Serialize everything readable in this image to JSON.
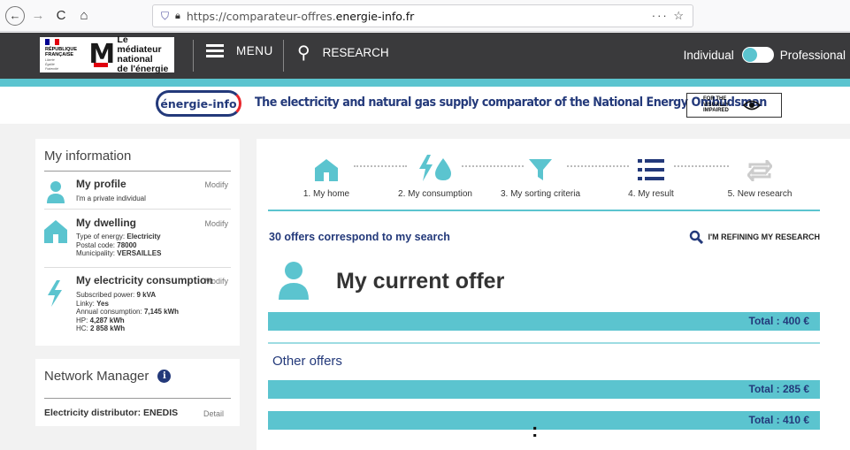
{
  "browser": {
    "url_prefix": "https://comparateur-offres.",
    "url_domain": "energie-info.fr",
    "actions": "··· ☆"
  },
  "header": {
    "republique": [
      "RÉPUBLIQUE",
      "FRANÇAISE"
    ],
    "motto": [
      "Liberté",
      "Égalité",
      "Fraternité"
    ],
    "mediateur": [
      "Le médiateur",
      "national",
      "de l'énergie"
    ],
    "menu_label": "MENU",
    "research_label": "RESEARCH",
    "toggle_left": "Individual",
    "toggle_right": "Professional"
  },
  "banner": {
    "logo_text": "énergie-info",
    "title": "The electricity and natural gas supply comparator of the National Energy Ombudsman",
    "visually_impaired": [
      "FOR THE",
      "VISUALLY",
      "IMPAIRED"
    ]
  },
  "my_information": {
    "title": "My information",
    "profile": {
      "title": "My profile",
      "modify": "Modify",
      "subtitle": "I'm a private individual"
    },
    "dwelling": {
      "title": "My dwelling",
      "modify": "Modify",
      "lines": [
        {
          "label": "Type of energy: ",
          "value": "Electricity"
        },
        {
          "label": "Postal code: ",
          "value": "78000"
        },
        {
          "label": "Municipality: ",
          "value": "VERSAILLES"
        }
      ]
    },
    "consumption": {
      "title": "My electricity consumption",
      "modify": "Modify",
      "lines": [
        {
          "label": "Subscribed power: ",
          "value": "9 kVA"
        },
        {
          "label": "Linky: ",
          "value": "Yes"
        },
        {
          "label": "Annual consumption: ",
          "value": "7,145 kWh"
        },
        {
          "label": "HP: ",
          "value": "4,287 kWh"
        },
        {
          "label": "HC: ",
          "value": "2 858 kWh"
        }
      ]
    }
  },
  "network": {
    "title": "Network Manager",
    "info_glyph": "i",
    "distributor": "Electricity distributor: ENEDIS",
    "detail": "Detail"
  },
  "steps": [
    {
      "label": "1. My home",
      "icon": "home-icon"
    },
    {
      "label": "2. My consumption",
      "icon": "bolt-drop-icon"
    },
    {
      "label": "3. My sorting criteria",
      "icon": "funnel-icon"
    },
    {
      "label": "4. My result",
      "icon": "list-icon"
    },
    {
      "label": "5. New research",
      "icon": "repeat-icon"
    }
  ],
  "results": {
    "count_text": "30 offers correspond to my search",
    "refine_label": "I'M REFINING MY RESEARCH",
    "current_title": "My current offer",
    "current_total": "Total : 400 €",
    "other_title": "Other offers",
    "other_totals": [
      "Total : 285 €",
      "Total : 410 €"
    ],
    "more_glyph": ":"
  },
  "colors": {
    "teal": "#5bc4cf",
    "navy": "#23397a",
    "header_dark": "#3a3a3c",
    "red": "#e8262c"
  }
}
